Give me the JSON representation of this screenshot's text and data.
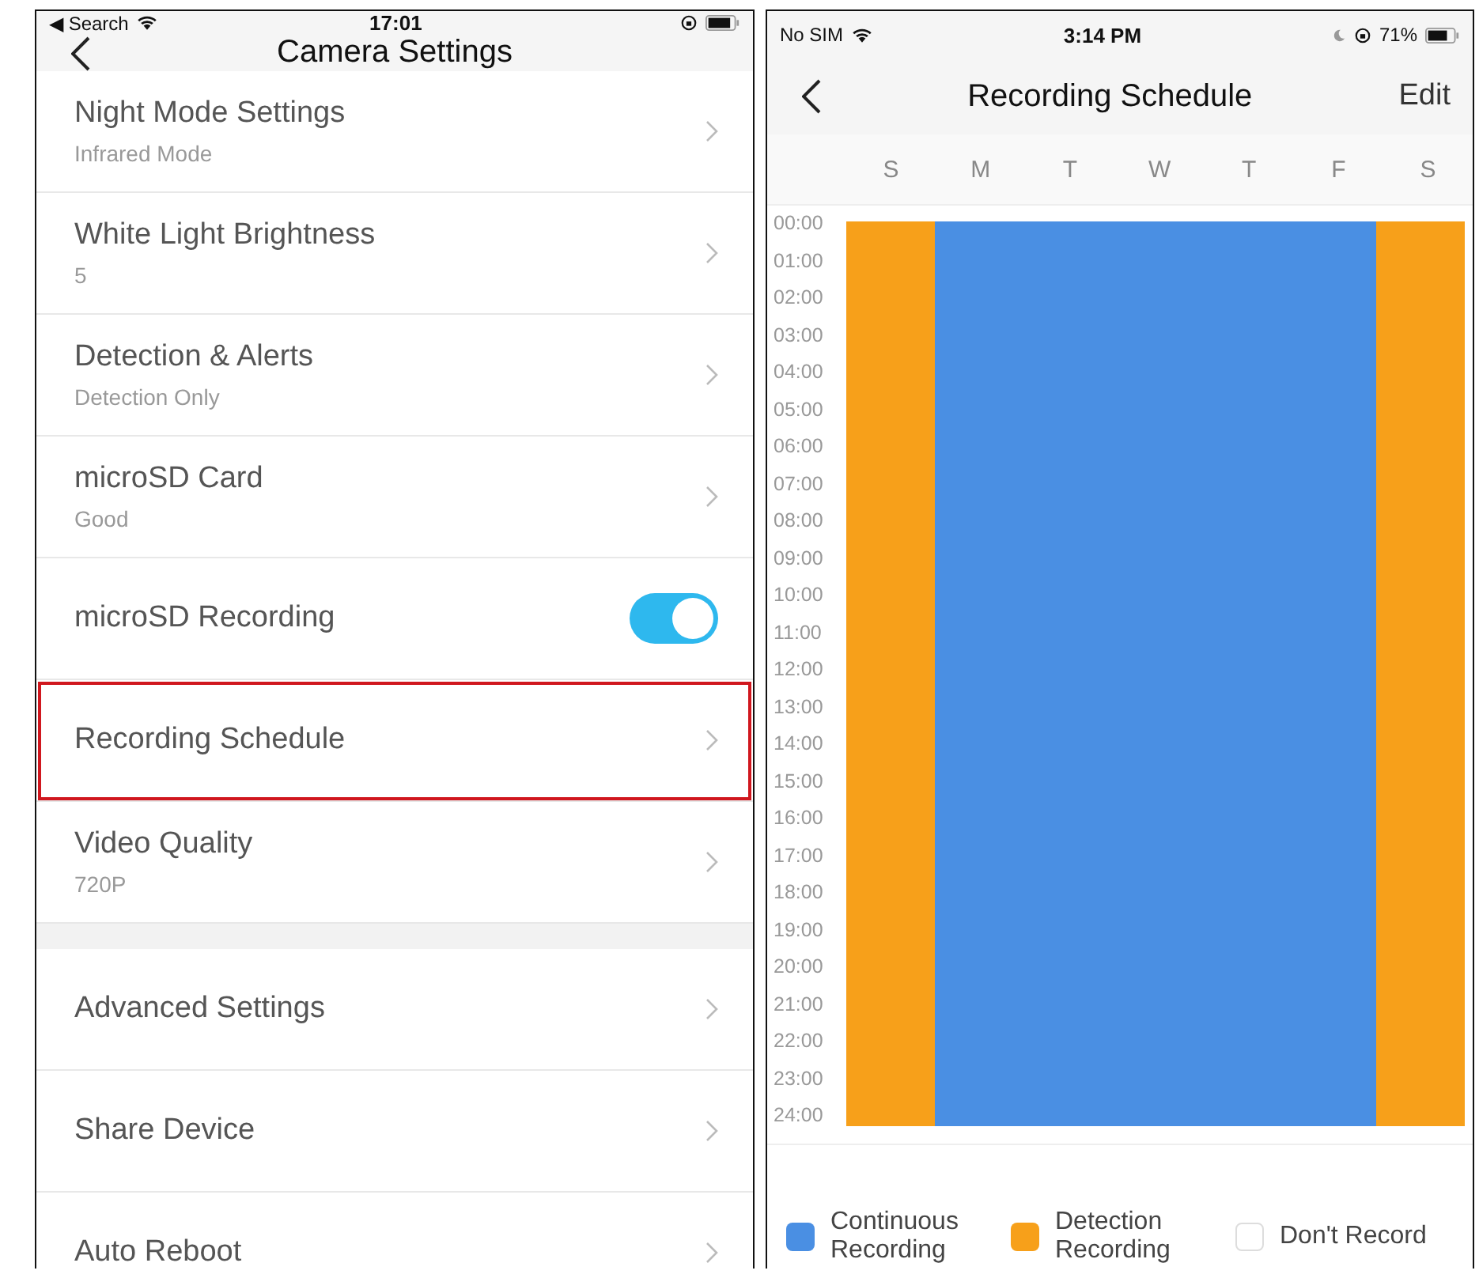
{
  "left": {
    "status_bar": {
      "back": "◀ Search",
      "time": "17:01"
    },
    "title": "Camera Settings",
    "sections": [
      {
        "items": [
          {
            "kind": "nav",
            "label": "Night Mode Settings",
            "value": "Infrared Mode",
            "highlighted": false
          },
          {
            "kind": "nav",
            "label": "White Light Brightness",
            "value": "5",
            "highlighted": false
          },
          {
            "kind": "nav",
            "label": "Detection & Alerts",
            "value": "Detection Only",
            "highlighted": false
          },
          {
            "kind": "nav",
            "label": "microSD Card",
            "value": "Good",
            "highlighted": false
          },
          {
            "kind": "toggle",
            "label": "microSD Recording",
            "on": true,
            "highlighted": false
          },
          {
            "kind": "nav",
            "label": "Recording Schedule",
            "highlighted": true
          },
          {
            "kind": "nav",
            "label": "Video Quality",
            "value": "720P",
            "highlighted": false
          }
        ]
      },
      {
        "items": [
          {
            "kind": "nav",
            "label": "Advanced Settings",
            "highlighted": false
          },
          {
            "kind": "nav",
            "label": "Share Device",
            "highlighted": false
          },
          {
            "kind": "nav",
            "label": "Auto Reboot",
            "highlighted": false
          }
        ]
      }
    ]
  },
  "right": {
    "status_bar": {
      "carrier": "No SIM",
      "time": "3:14 PM",
      "battery": "71%"
    },
    "title": "Recording Schedule",
    "action": "Edit",
    "days": [
      {
        "label": "S",
        "color": "#f7a01a"
      },
      {
        "label": "M",
        "color": "#4a8fe3"
      },
      {
        "label": "T",
        "color": "#4a8fe3"
      },
      {
        "label": "W",
        "color": "#4a8fe3"
      },
      {
        "label": "T",
        "color": "#4a8fe3"
      },
      {
        "label": "F",
        "color": "#4a8fe3"
      },
      {
        "label": "S",
        "color": "#f7a01a"
      }
    ],
    "hours": [
      "00:00",
      "01:00",
      "02:00",
      "03:00",
      "04:00",
      "05:00",
      "06:00",
      "07:00",
      "08:00",
      "09:00",
      "10:00",
      "11:00",
      "12:00",
      "13:00",
      "14:00",
      "15:00",
      "16:00",
      "17:00",
      "18:00",
      "19:00",
      "20:00",
      "21:00",
      "22:00",
      "23:00",
      "24:00"
    ],
    "legend": [
      {
        "kind": "continuous",
        "label": "Continuous Recording",
        "color": "#4a8fe3"
      },
      {
        "kind": "detection",
        "label": "Detection Recording",
        "color": "#f7a01a"
      },
      {
        "kind": "none",
        "label": "Don't Record"
      }
    ]
  }
}
